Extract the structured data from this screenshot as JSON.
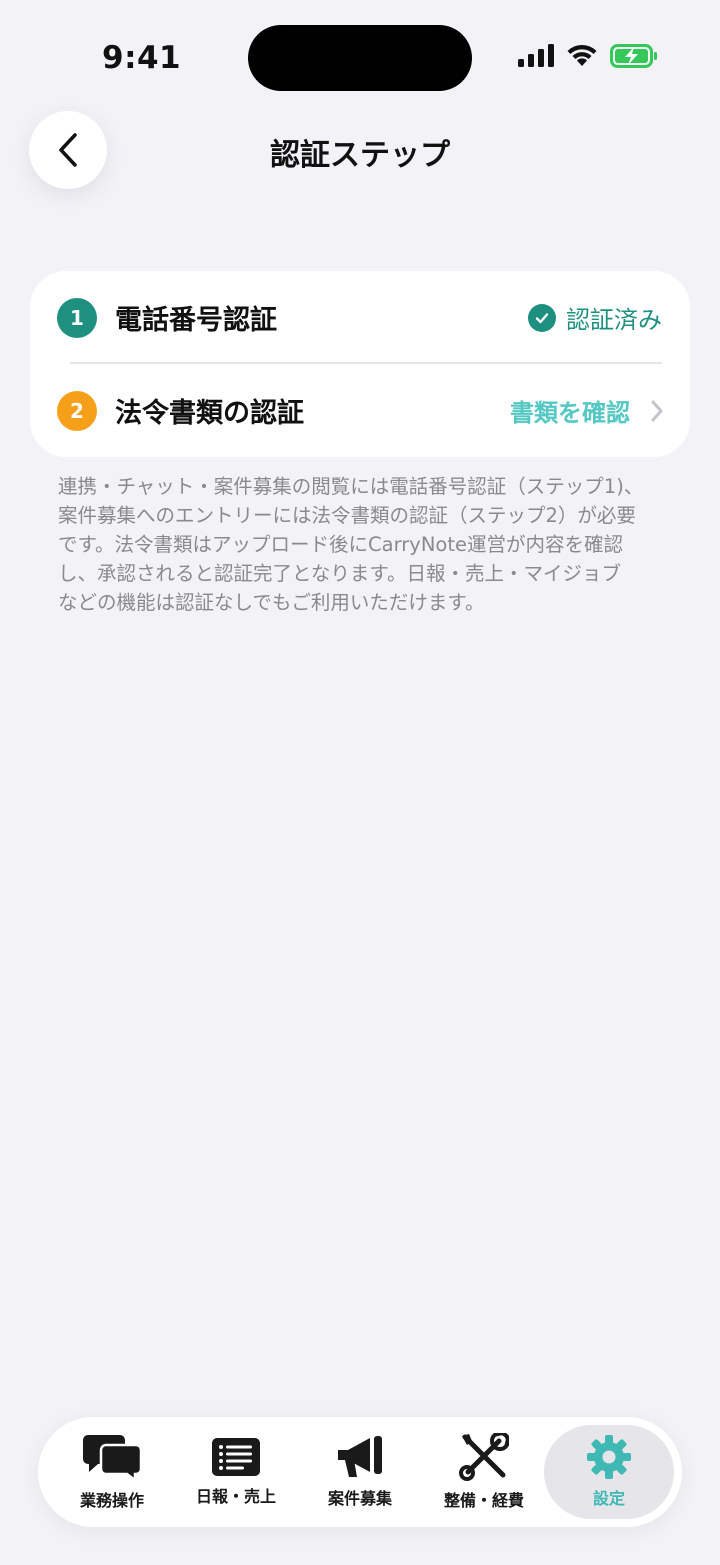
{
  "status_bar": {
    "time": "9:41"
  },
  "header": {
    "title": "認証ステップ"
  },
  "steps": [
    {
      "number": "1",
      "label": "電話番号認証",
      "status": "認証済み"
    },
    {
      "number": "2",
      "label": "法令書類の認証",
      "action": "書類を確認"
    }
  ],
  "description_lines": [
    "連携・チャット・案件募集の閲覧には電話番号認証（ステップ1)、",
    "案件募集へのエントリーには法令書類の認証（ステップ2）が必要",
    "です。法令書類はアップロード後にCarryNote運営が内容を確認",
    "し、承認されると認証完了となります。日報・売上・マイジョブ",
    "などの機能は認証なしでもご利用いただけます。"
  ],
  "tabs": [
    {
      "label": "業務操作",
      "icon": "chat-bubbles-icon"
    },
    {
      "label": "日報・売上",
      "icon": "list-icon"
    },
    {
      "label": "案件募集",
      "icon": "megaphone-icon"
    },
    {
      "label": "整備・経費",
      "icon": "tools-icon"
    },
    {
      "label": "設定",
      "icon": "gear-icon",
      "active": true
    }
  ],
  "colors": {
    "teal": "#1e9080",
    "orange": "#f6a01a",
    "accent_light": "#55c8c4",
    "background": "#f2f2f7"
  }
}
